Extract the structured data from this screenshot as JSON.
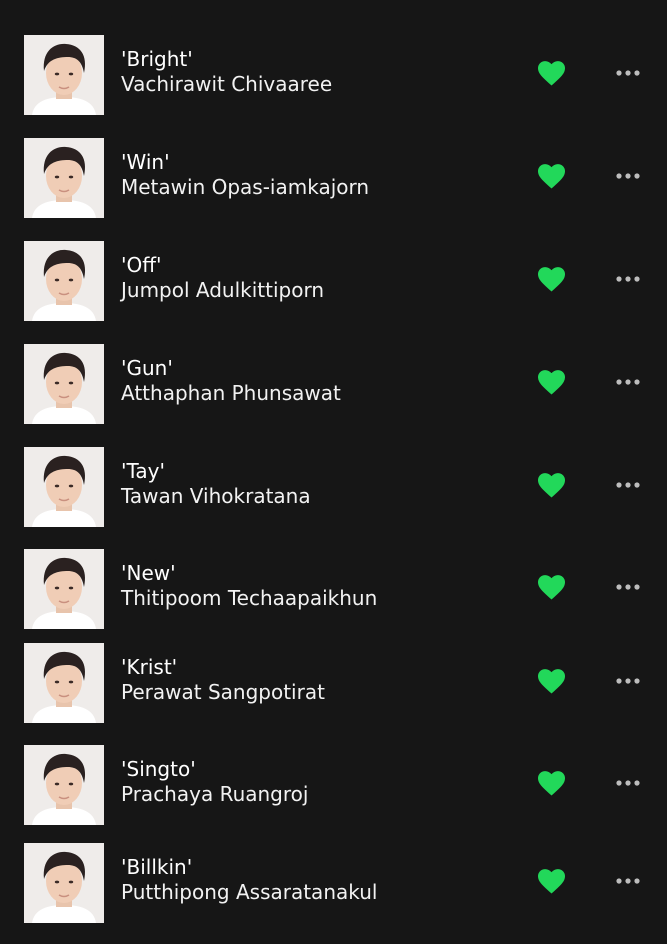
{
  "colors": {
    "background": "#161616",
    "text": "#ffffff",
    "liked": "#22d85a",
    "more": "#bdbdbd"
  },
  "icons": {
    "like": "heart-icon",
    "more": "more-horizontal-icon"
  },
  "artists": [
    {
      "nickname": "'Bright'",
      "name": "Vachirawit Chivaaree",
      "liked": true
    },
    {
      "nickname": "'Win'",
      "name": "Metawin Opas-iamkajorn",
      "liked": true
    },
    {
      "nickname": "'Off'",
      "name": "Jumpol Adulkittiporn",
      "liked": true
    },
    {
      "nickname": "'Gun'",
      "name": "Atthaphan Phunsawat",
      "liked": true
    },
    {
      "nickname": "'Tay'",
      "name": "Tawan Vihokratana",
      "liked": true
    },
    {
      "nickname": "'New'",
      "name": "Thitipoom Techaapaikhun",
      "liked": true
    },
    {
      "nickname": "'Krist'",
      "name": "Perawat Sangpotirat",
      "liked": true
    },
    {
      "nickname": "'Singto'",
      "name": "Prachaya Ruangroj",
      "liked": true
    },
    {
      "nickname": "'Billkin'",
      "name": "Putthipong Assaratanakul",
      "liked": true
    }
  ]
}
